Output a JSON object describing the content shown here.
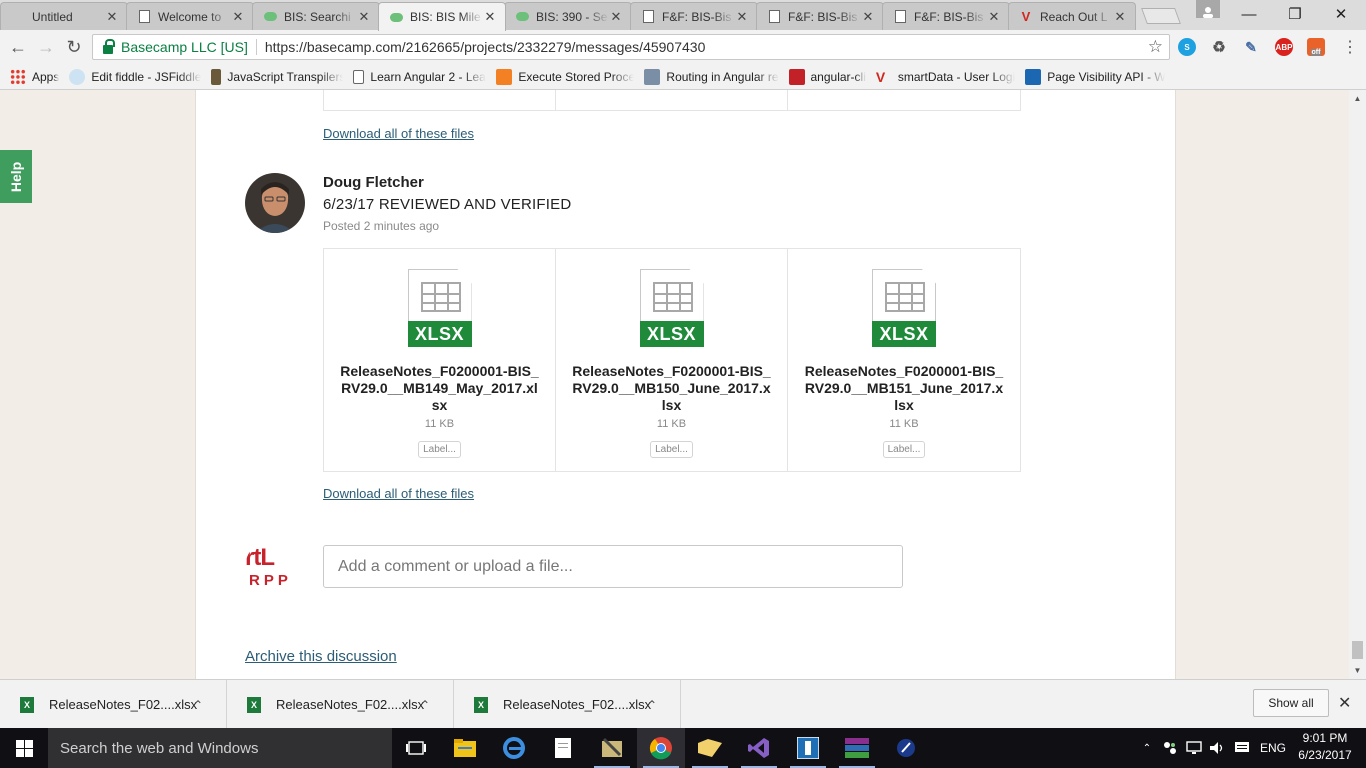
{
  "browser": {
    "tabs": [
      {
        "title": "Untitled",
        "icon": "none",
        "active": false
      },
      {
        "title": "Welcome to",
        "icon": "document-icon",
        "active": false
      },
      {
        "title": "BIS: Searchi",
        "icon": "basecamp-icon",
        "active": false
      },
      {
        "title": "BIS: BIS Mile",
        "icon": "basecamp-icon",
        "active": true
      },
      {
        "title": "BIS: 390 - Se",
        "icon": "basecamp-icon",
        "active": false
      },
      {
        "title": "F&F: BIS-Bis",
        "icon": "document-icon",
        "active": false
      },
      {
        "title": "F&F: BIS-Bis",
        "icon": "document-icon",
        "active": false
      },
      {
        "title": "F&F: BIS-Bis",
        "icon": "document-icon",
        "active": false
      },
      {
        "title": "Reach Out L",
        "icon": "v-logo-icon",
        "active": false
      }
    ],
    "tab_close_glyph": "✕",
    "security_label": "Basecamp LLC [US]",
    "url": "https://basecamp.com/2162665/projects/2332279/messages/45907430",
    "bookmarks": [
      {
        "label": "Apps",
        "icon": "apps-grid-icon"
      },
      {
        "label": "Edit fiddle - JSFiddle",
        "icon": "jsfiddle-icon"
      },
      {
        "label": "JavaScript Transpilers:",
        "icon": "person-icon"
      },
      {
        "label": "Learn Angular 2 - Lear",
        "icon": "document-icon"
      },
      {
        "label": "Execute Stored Proced",
        "icon": "stackoverflow-icon"
      },
      {
        "label": "Routing in Angular re",
        "icon": "image-icon"
      },
      {
        "label": "angular-cli",
        "icon": "npm-icon"
      },
      {
        "label": "smartData - User Logi",
        "icon": "v-logo-icon"
      },
      {
        "label": "Page Visibility API - W",
        "icon": "mdn-icon"
      }
    ],
    "extensions": {
      "abp_label": "ABP",
      "off_label": "off"
    }
  },
  "page": {
    "help_label": "Help",
    "download_all_label": "Download all of these files",
    "message": {
      "author": "Doug Fletcher",
      "title": "6/23/17 REVIEWED AND VERIFIED",
      "posted_prefix": "Posted ",
      "posted_time": "2 minutes ago",
      "files": [
        {
          "name": "ReleaseNotes_F0200001-BIS_RV29.0__MB149_May_2017.xlsx",
          "size": "11 KB",
          "badge": "XLSX",
          "label_button": "Label..."
        },
        {
          "name": "ReleaseNotes_F0200001-BIS_RV29.0__MB150_June_2017.xlsx",
          "size": "11 KB",
          "badge": "XLSX",
          "label_button": "Label..."
        },
        {
          "name": "ReleaseNotes_F0200001-BIS_RV29.0__MB151_June_2017.xlsx",
          "size": "11 KB",
          "badge": "XLSX",
          "label_button": "Label..."
        }
      ]
    },
    "commenter_logo_line1": "rtL",
    "commenter_logo_line2": "RPP",
    "comment_placeholder": "Add a comment or upload a file...",
    "archive_label": "Archive this discussion"
  },
  "downloads": {
    "items": [
      {
        "name": "ReleaseNotes_F02....xlsx"
      },
      {
        "name": "ReleaseNotes_F02....xlsx"
      },
      {
        "name": "ReleaseNotes_F02....xlsx"
      }
    ],
    "show_all_label": "Show all"
  },
  "taskbar": {
    "search_placeholder": "Search the web and Windows",
    "language": "ENG",
    "time": "9:01 PM",
    "date": "6/23/2017"
  },
  "colors": {
    "accent_green": "#3f9e5e",
    "link_blue": "#2b5d77",
    "excel_green": "#1e8a3a"
  }
}
